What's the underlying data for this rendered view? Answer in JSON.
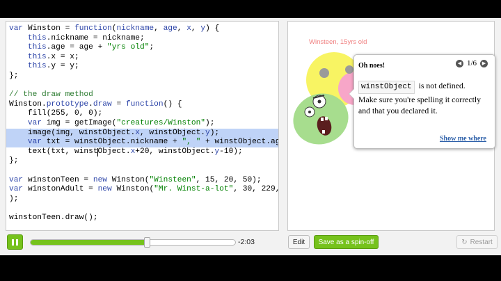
{
  "editor": {
    "lines": [
      {
        "segs": [
          {
            "t": "var ",
            "c": "kw"
          },
          {
            "t": "Winston = "
          },
          {
            "t": "function",
            "c": "kw"
          },
          {
            "t": "("
          },
          {
            "t": "nickname",
            "c": "prop"
          },
          {
            "t": ", "
          },
          {
            "t": "age",
            "c": "prop"
          },
          {
            "t": ", "
          },
          {
            "t": "x",
            "c": "prop"
          },
          {
            "t": ", "
          },
          {
            "t": "y",
            "c": "prop"
          },
          {
            "t": ") {"
          }
        ]
      },
      {
        "segs": [
          {
            "t": "    "
          },
          {
            "t": "this",
            "c": "kw"
          },
          {
            "t": ".nickname = nickname;"
          }
        ]
      },
      {
        "segs": [
          {
            "t": "    "
          },
          {
            "t": "this",
            "c": "kw"
          },
          {
            "t": ".age = age + "
          },
          {
            "t": "\"yrs old\"",
            "c": "str"
          },
          {
            "t": ";"
          }
        ]
      },
      {
        "segs": [
          {
            "t": "    "
          },
          {
            "t": "this",
            "c": "kw"
          },
          {
            "t": ".x = x;"
          }
        ]
      },
      {
        "segs": [
          {
            "t": "    "
          },
          {
            "t": "this",
            "c": "kw"
          },
          {
            "t": ".y = y;"
          }
        ]
      },
      {
        "segs": [
          {
            "t": "};"
          }
        ]
      },
      {
        "segs": [
          {
            "t": ""
          }
        ]
      },
      {
        "segs": [
          {
            "t": "// the draw method",
            "c": "cm"
          }
        ]
      },
      {
        "segs": [
          {
            "t": "Winston."
          },
          {
            "t": "prototype",
            "c": "prop"
          },
          {
            "t": "."
          },
          {
            "t": "draw",
            "c": "prop"
          },
          {
            "t": " = "
          },
          {
            "t": "function",
            "c": "kw"
          },
          {
            "t": "() {"
          }
        ]
      },
      {
        "segs": [
          {
            "t": "    fill(255, 0, 0);"
          }
        ]
      },
      {
        "segs": [
          {
            "t": "    "
          },
          {
            "t": "var",
            "c": "kw"
          },
          {
            "t": " img = getImage("
          },
          {
            "t": "\"creatures/Winston\"",
            "c": "str"
          },
          {
            "t": ");"
          }
        ]
      },
      {
        "hl": true,
        "segs": [
          {
            "t": "    image(img, winstObject."
          },
          {
            "t": "x",
            "c": "prop"
          },
          {
            "t": ", winstObject."
          },
          {
            "t": "y",
            "c": "prop"
          },
          {
            "t": ");"
          }
        ]
      },
      {
        "hl": true,
        "segs": [
          {
            "t": "    "
          },
          {
            "t": "var",
            "c": "kw"
          },
          {
            "t": " txt = winstObject.nickname + "
          },
          {
            "t": "\", \"",
            "c": "str"
          },
          {
            "t": " + winstObject.age;"
          }
        ]
      },
      {
        "segs": [
          {
            "t": "    text(txt, winstObject."
          },
          {
            "t": "x",
            "c": "prop"
          },
          {
            "t": "+20, winstObject."
          },
          {
            "t": "y",
            "c": "prop"
          },
          {
            "t": "-10);"
          }
        ]
      },
      {
        "segs": [
          {
            "t": "};"
          }
        ]
      },
      {
        "segs": [
          {
            "t": ""
          }
        ]
      },
      {
        "segs": [
          {
            "t": "var",
            "c": "kw"
          },
          {
            "t": " winstonTeen = "
          },
          {
            "t": "new",
            "c": "kw"
          },
          {
            "t": " Winston("
          },
          {
            "t": "\"Winsteen\"",
            "c": "str"
          },
          {
            "t": ", 15, 20, 50);"
          }
        ]
      },
      {
        "segs": [
          {
            "t": "var",
            "c": "kw"
          },
          {
            "t": " winstonAdult = "
          },
          {
            "t": "new",
            "c": "kw"
          },
          {
            "t": " Winston("
          },
          {
            "t": "\"Mr. Winst-a-lot\"",
            "c": "str"
          },
          {
            "t": ", 30, 229, 50"
          }
        ]
      },
      {
        "segs": [
          {
            "t": ");"
          }
        ]
      },
      {
        "segs": [
          {
            "t": ""
          }
        ]
      },
      {
        "segs": [
          {
            "t": "winstonTeen.draw();"
          }
        ]
      }
    ]
  },
  "canvas": {
    "label": "Winsteen, 15yrs old"
  },
  "error": {
    "title": "Oh noes!",
    "page": "1/6",
    "code": "winstObject",
    "message_1": "is not defined.",
    "message_2": "Make sure you're spelling it correctly and that you declared it.",
    "link": "Show me where"
  },
  "player": {
    "time": "-2:03",
    "progress": 0.57
  },
  "buttons": {
    "edit": "Edit",
    "spinoff": "Save as a spin-off",
    "restart": "Restart"
  },
  "colors": {
    "accent": "#76c21c",
    "highlight": "#bfd3f7",
    "link": "#2b5ea8"
  }
}
